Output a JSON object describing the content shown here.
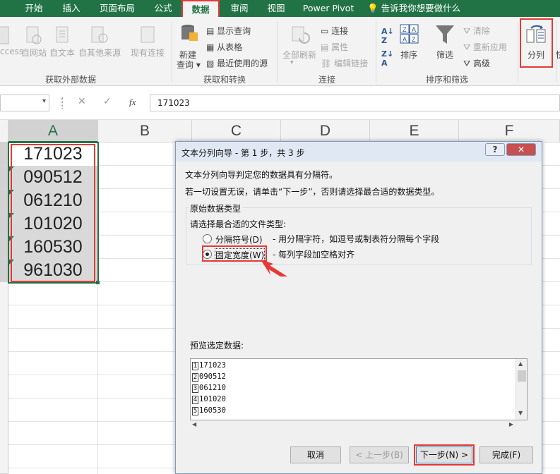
{
  "ribbon_tabs": [
    "开始",
    "插入",
    "页面布局",
    "公式",
    "数据",
    "审阅",
    "视图",
    "Power Pivot"
  ],
  "tell_me": "告诉我你想要做什么",
  "ribbon": {
    "access": "ccess",
    "web": "自网站",
    "text": "自文本",
    "other": "自其他来源",
    "existing": "现有连接",
    "group1": "获取外部数据",
    "new_query_1": "新建",
    "new_query_2": "查询",
    "show_query": "显示查询",
    "from_table": "从表格",
    "recent_sources": "最近使用的源",
    "group2": "获取和转换",
    "refresh_all": "全部刷新",
    "connections": "连接",
    "properties": "属性",
    "edit_links": "编辑链接",
    "group3": "连接",
    "sort": "排序",
    "filter": "筛选",
    "clear": "清除",
    "reapply": "重新应用",
    "advanced": "高级",
    "group4": "排序和筛选",
    "split": "分列",
    "quick": "快"
  },
  "formula_bar": {
    "cancel": "✕",
    "confirm": "✓",
    "fx": "fx",
    "value": "171023"
  },
  "columns": [
    "A",
    "B",
    "C",
    "D",
    "E",
    "F"
  ],
  "cells": [
    "171023",
    "090512",
    "061210",
    "101020",
    "160530",
    "961030"
  ],
  "dialog": {
    "title": "文本分列向导 - 第 1 步，共 3 步",
    "help_btn": "?",
    "close_btn": "✕",
    "line1": "文本分列向导判定您的数据具有分隔符。",
    "line2": "若一切设置无误，请单击“下一步”，否则请选择最合适的数据类型。",
    "group_title": "原始数据类型",
    "choose_label": "请选择最合适的文件类型:",
    "opt1": "分隔符号(D)",
    "opt1_desc": "- 用分隔字符，如逗号或制表符分隔每个字段",
    "opt2": "固定宽度(W)",
    "opt2_desc": "- 每列字段加空格对齐",
    "preview_label": "预览选定数据:",
    "preview_rows": [
      {
        "n": "1",
        "v": "171023"
      },
      {
        "n": "2",
        "v": "090512"
      },
      {
        "n": "3",
        "v": "061210"
      },
      {
        "n": "4",
        "v": "101020"
      },
      {
        "n": "5",
        "v": "160530"
      }
    ],
    "cancel": "取消",
    "back": "< 上一步(B)",
    "next": "下一步(N) >",
    "finish": "完成(F)"
  },
  "colors": {
    "excel_green": "#217346",
    "highlight_red": "#e53935"
  }
}
